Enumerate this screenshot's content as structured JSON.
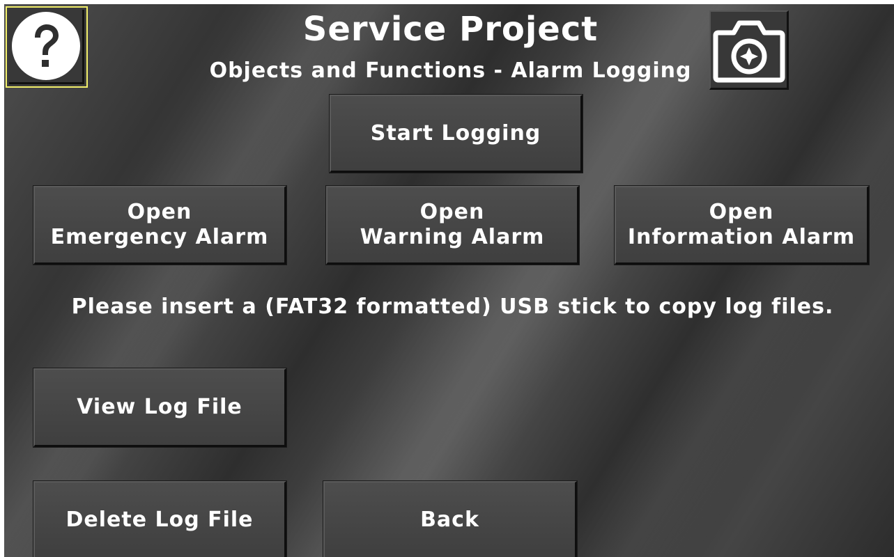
{
  "header": {
    "title": "Service Project",
    "subtitle": "Objects and Functions - Alarm Logging"
  },
  "icons": {
    "help": "help-icon",
    "screenshot": "camera-icon"
  },
  "buttons": {
    "start_logging": "Start Logging",
    "open_emergency": [
      "Open",
      "Emergency Alarm"
    ],
    "open_warning": [
      "Open",
      "Warning Alarm"
    ],
    "open_information": [
      "Open",
      "Information Alarm"
    ],
    "view_log": "View Log File",
    "delete_log": "Delete Log File",
    "back": "Back"
  },
  "message": "Please insert a (FAT32 formatted) USB stick to copy log files.",
  "colors": {
    "text": "#ffffff",
    "focus_border": "#f2ef6a",
    "button_face": "#464646"
  }
}
